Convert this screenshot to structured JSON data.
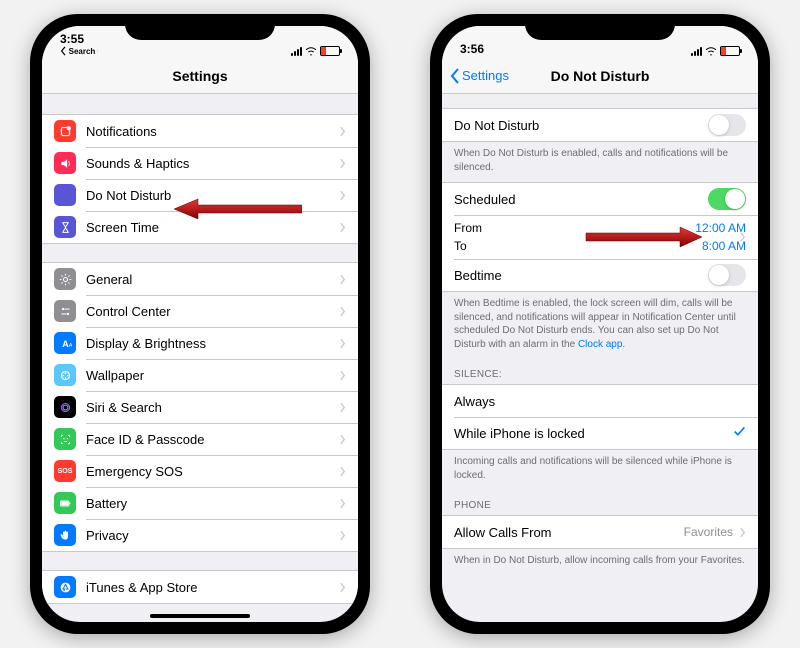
{
  "left": {
    "status_time": "3:55",
    "status_back": "Search",
    "nav_title": "Settings",
    "groups": [
      {
        "rows": [
          {
            "icon": "notifications-icon",
            "color": "ic-red",
            "label": "Notifications"
          },
          {
            "icon": "sounds-icon",
            "color": "ic-pink",
            "label": "Sounds & Haptics"
          },
          {
            "icon": "moon-icon",
            "color": "ic-purple",
            "label": "Do Not Disturb"
          },
          {
            "icon": "hourglass-icon",
            "color": "ic-purple2",
            "label": "Screen Time"
          }
        ]
      },
      {
        "rows": [
          {
            "icon": "gear-icon",
            "color": "ic-gray",
            "label": "General"
          },
          {
            "icon": "switches-icon",
            "color": "ic-gray",
            "label": "Control Center"
          },
          {
            "icon": "display-icon",
            "color": "ic-blue",
            "label": "Display & Brightness"
          },
          {
            "icon": "wallpaper-icon",
            "color": "ic-cyan",
            "label": "Wallpaper"
          },
          {
            "icon": "siri-icon",
            "color": "ic-black",
            "label": "Siri & Search"
          },
          {
            "icon": "faceid-icon",
            "color": "ic-green",
            "label": "Face ID & Passcode"
          },
          {
            "icon": "sos-icon",
            "color": "ic-sos",
            "label": "Emergency SOS",
            "text": "SOS"
          },
          {
            "icon": "battery-icon",
            "color": "ic-green",
            "label": "Battery"
          },
          {
            "icon": "hand-icon",
            "color": "ic-blue",
            "label": "Privacy"
          }
        ]
      },
      {
        "rows": [
          {
            "icon": "appstore-icon",
            "color": "ic-blue",
            "label": "iTunes & App Store"
          }
        ]
      }
    ]
  },
  "right": {
    "status_time": "3:56",
    "nav_back": "Settings",
    "nav_title": "Do Not Disturb",
    "dnd_label": "Do Not Disturb",
    "dnd_footer": "When Do Not Disturb is enabled, calls and notifications will be silenced.",
    "scheduled_label": "Scheduled",
    "from_label": "From",
    "from_value": "12:00 AM",
    "to_label": "To",
    "to_value": "8:00 AM",
    "bedtime_label": "Bedtime",
    "bedtime_footer": "When Bedtime is enabled, the lock screen will dim, calls will be silenced, and notifications will appear in Notification Center until scheduled Do Not Disturb ends. You can also set up Do Not Disturb with an alarm in the ",
    "bedtime_link": "Clock app.",
    "silence_header": "Silence:",
    "always_label": "Always",
    "while_locked_label": "While iPhone is locked",
    "silence_footer": "Incoming calls and notifications will be silenced while iPhone is locked.",
    "phone_header": "Phone",
    "allow_label": "Allow Calls From",
    "allow_value": "Favorites",
    "allow_footer": "When in Do Not Disturb, allow incoming calls from your Favorites."
  }
}
